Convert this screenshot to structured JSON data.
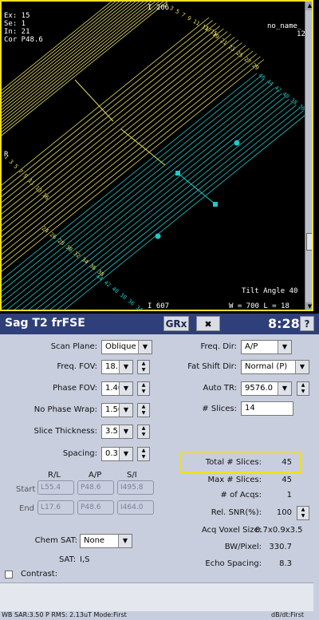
{
  "viewer": {
    "overlay_lines": [
      "Ex: 15",
      "Se: 1",
      "In: 21",
      "Cor P48.6"
    ],
    "top_label": "I 206",
    "bottom_label": "I 607",
    "right_name": "no_name_",
    "right_num": "12",
    "left_marker": "R",
    "tilt": "Tilt Angle  40",
    "wl": "W =    700 L =  18",
    "yellow_top_nums": "1 3 5 7 9 11 13 15",
    "yellow_mid_nums": "17 19 21 23 25 27 29",
    "yellow_left_nums": "1 3 5 7 9 11 13 16",
    "yellow_bottom_nums": "24 26 28 30 32 34 36 38",
    "cyan_top_nums": "46 44 42 40 38 36 34 32",
    "cyan_bottom_nums": "44 42 40 38 36 34 32"
  },
  "titlebar": {
    "title": "Sag T2 frFSE",
    "grx": "GRx",
    "x_btn": "✖",
    "time": "8:28",
    "help": "?"
  },
  "left_params": [
    {
      "label": "Scan Plane:",
      "value": "Oblique"
    },
    {
      "label": "Freq. FOV:",
      "value": "18.0"
    },
    {
      "label": "Phase FOV:",
      "value": "1.40"
    },
    {
      "label": "No Phase Wrap:",
      "value": "1.50"
    },
    {
      "label": "Slice Thickness:",
      "value": "3.5"
    },
    {
      "label": "Spacing:",
      "value": "0.3"
    }
  ],
  "right_params": {
    "freq_dir_label": "Freq. Dir:",
    "freq_dir": "A/P",
    "fat_shift_label": "Fat Shift Dir:",
    "fat_shift": "Normal (P)",
    "auto_tr_label": "Auto TR:",
    "auto_tr": "9576.0",
    "slices_label": "# Slices:",
    "slices": "14"
  },
  "location": {
    "headers": [
      "R/L",
      "A/P",
      "S/I"
    ],
    "start_label": "Start",
    "end_label": "End",
    "start": [
      "L55.4",
      "P48.6",
      "I495.8"
    ],
    "end": [
      "L17.6",
      "P48.6",
      "I464.0"
    ]
  },
  "stats": [
    {
      "label": "Total # Slices:",
      "value": "45"
    },
    {
      "label": "Max # Slices:",
      "value": "45"
    },
    {
      "label": "# of Acqs:",
      "value": "1"
    },
    {
      "label": "Rel. SNR(%):",
      "value": "100"
    },
    {
      "label": "Acq Voxel Size:",
      "value": "0.7x0.9x3.5"
    },
    {
      "label": "BW/Pixel:",
      "value": "330.7"
    },
    {
      "label": "Echo Spacing:",
      "value": "8.3"
    }
  ],
  "chem_sat": {
    "label": "Chem SAT:",
    "value": "None"
  },
  "sat": {
    "label": "SAT:",
    "value": "I,S"
  },
  "contrast": {
    "label": "Contrast:"
  },
  "bottom_status": {
    "left": "WB  SAR:3.50  P   RMS: 2.13uT  Mode:First",
    "right": "dB/dt:First"
  },
  "colors": {
    "yellow": "#e8e060",
    "cyan": "#20c8c8",
    "title_bg": "#2e3f79",
    "panel_bg": "#c8cede",
    "highlight": "#f0e020"
  }
}
